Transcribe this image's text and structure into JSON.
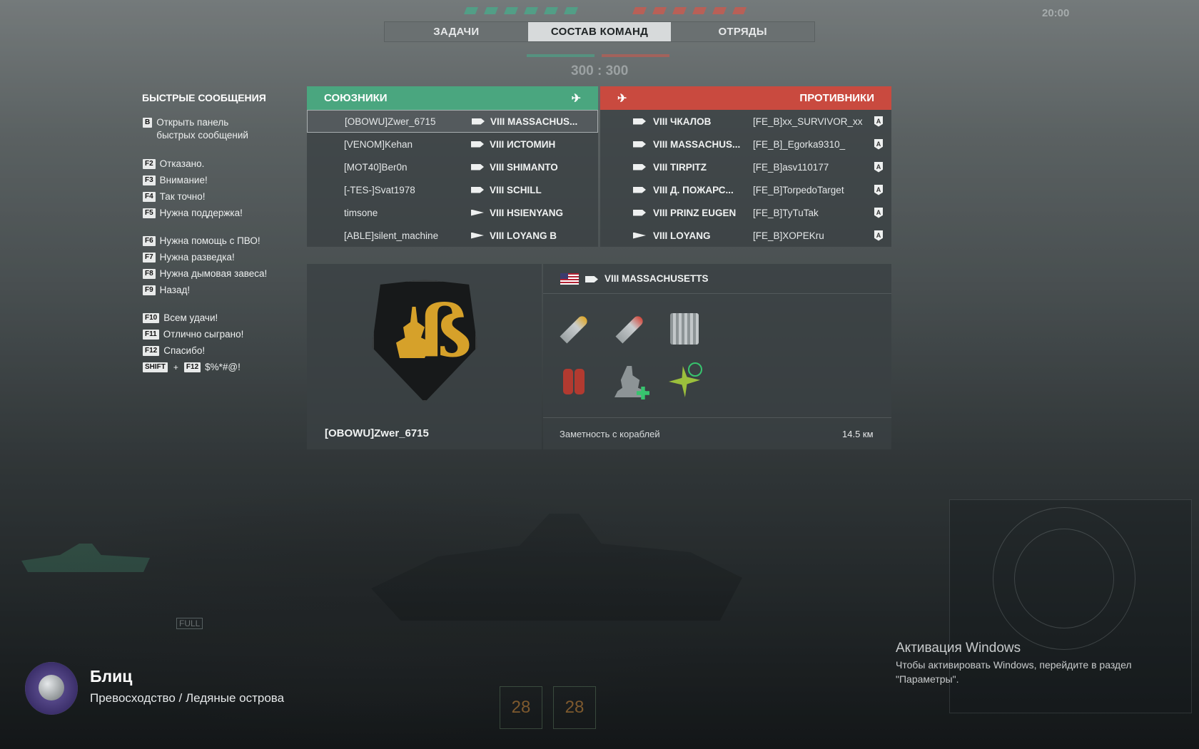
{
  "hud": {
    "timer": "20:00",
    "score": "300 : 300",
    "full_label": "FULL",
    "bottom_slots": [
      "28",
      "28"
    ]
  },
  "tabs": [
    {
      "label": "ЗАДАЧИ",
      "active": false
    },
    {
      "label": "СОСТАВ КОМАНД",
      "active": true
    },
    {
      "label": "ОТРЯДЫ",
      "active": false
    }
  ],
  "quick_messages": {
    "title": "БЫСТРЫЕ СООБЩЕНИЯ",
    "items": [
      {
        "key": "B",
        "text": "Открыть панель",
        "text2": "быстрых сообщений"
      },
      {
        "key": "F2",
        "text": "Отказано."
      },
      {
        "key": "F3",
        "text": "Внимание!"
      },
      {
        "key": "F4",
        "text": "Так точно!"
      },
      {
        "key": "F5",
        "text": "Нужна поддержка!"
      },
      {
        "key": "F6",
        "text": "Нужна помощь с ПВО!"
      },
      {
        "key": "F7",
        "text": "Нужна разведка!"
      },
      {
        "key": "F8",
        "text": "Нужна дымовая завеса!"
      },
      {
        "key": "F9",
        "text": "Назад!"
      },
      {
        "key": "F10",
        "text": "Всем удачи!"
      },
      {
        "key": "F11",
        "text": "Отлично сыграно!"
      },
      {
        "key": "F12",
        "text": "Спасибо!"
      }
    ],
    "combo": {
      "key1": "SHIFT",
      "plus": "+",
      "key2": "F12",
      "text": "$%*#@!"
    }
  },
  "allies": {
    "title": "СОЮЗНИКИ",
    "color": "#4aa67f",
    "rows": [
      {
        "player": "[OBOWU]Zwer_6715",
        "class": "bb",
        "tier": "VIII",
        "ship": "MASSACHUS...",
        "selected": true
      },
      {
        "player": "[VENOM]Kehan",
        "class": "bb",
        "tier": "VIII",
        "ship": "ИСТОМИН"
      },
      {
        "player": "[MOT40]Ber0n",
        "class": "bb",
        "tier": "VIII",
        "ship": "SHIMANTO"
      },
      {
        "player": "[-TES-]Svat1978",
        "class": "bb",
        "tier": "VIII",
        "ship": "SCHILL"
      },
      {
        "player": "timsone",
        "class": "dd",
        "tier": "VIII",
        "ship": "HSIENYANG"
      },
      {
        "player": "[ABLE]silent_machine",
        "class": "dd",
        "tier": "VIII",
        "ship": "LOYANG B"
      }
    ]
  },
  "enemies": {
    "title": "ПРОТИВНИКИ",
    "color": "#c94a3f",
    "rows": [
      {
        "class": "cv",
        "tier": "VIII",
        "ship": "ЧКАЛОВ",
        "player": "[FE_B]xx_SURVIVOR_xx",
        "bot": "A"
      },
      {
        "class": "bb",
        "tier": "VIII",
        "ship": "MASSACHUS...",
        "player": "[FE_B]_Egorka9310_",
        "bot": "A"
      },
      {
        "class": "bb",
        "tier": "VIII",
        "ship": "TIRPITZ",
        "player": "[FE_B]asv110177",
        "bot": "A"
      },
      {
        "class": "bb",
        "tier": "VIII",
        "ship": "Д. ПОЖАРС...",
        "player": "[FE_B]TorpedoTarget",
        "bot": "A"
      },
      {
        "class": "bb",
        "tier": "VIII",
        "ship": "PRINZ EUGEN",
        "player": "[FE_B]TyTuTak",
        "bot": "A"
      },
      {
        "class": "dd",
        "tier": "VIII",
        "ship": "LOYANG",
        "player": "[FE_B]XOPEKru",
        "bot": "A"
      }
    ]
  },
  "detail": {
    "player": "[OBOWU]Zwer_6715",
    "tier": "VIII",
    "ship": "MASSACHUSETTS",
    "nation": "usa",
    "consumables": [
      "ap-shell-icon",
      "he-shell-icon",
      "smoke-barrel-icon",
      "damage-control-icon",
      "repair-party-icon",
      "spotter-plane-icon"
    ],
    "concealment_label": "Заметность с кораблей",
    "concealment_value": "14.5 км"
  },
  "mode": {
    "title": "Блиц",
    "subtitle": "Превосходство / Ледяные острова"
  },
  "windows": {
    "title": "Активация Windows",
    "text": "Чтобы активировать Windows, перейдите в раздел \"Параметры\"."
  }
}
